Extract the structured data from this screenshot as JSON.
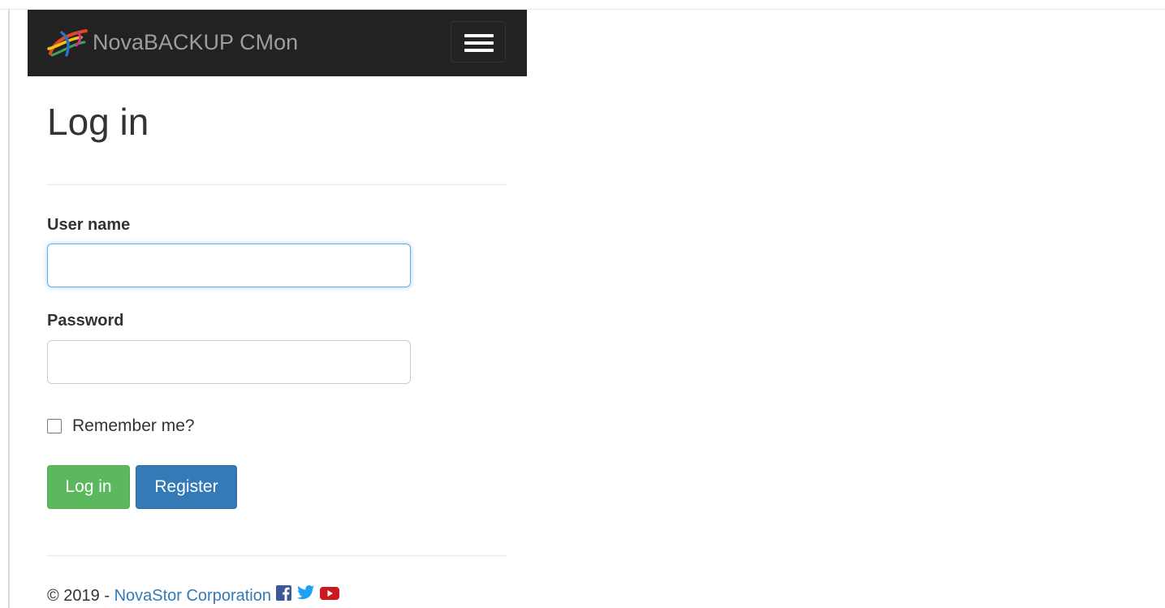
{
  "app": {
    "brand_name": "NovaBACKUP CMon"
  },
  "page": {
    "title": "Log in"
  },
  "form": {
    "username_label": "User name",
    "username_value": "",
    "password_label": "Password",
    "password_value": "",
    "remember_label": "Remember me?",
    "remember_checked": false,
    "login_button": "Log in",
    "register_button": "Register"
  },
  "footer": {
    "copyright": "© 2019 - ",
    "company_link": "NovaStor Corporation",
    "social_icons": [
      "facebook-icon",
      "twitter-icon",
      "youtube-icon"
    ]
  },
  "colors": {
    "navbar_bg": "#222222",
    "brand_text": "#9d9d9d",
    "login_button": "#5cb85c",
    "register_button": "#337ab7",
    "link": "#337ab7",
    "focus_border": "#66afe9"
  }
}
